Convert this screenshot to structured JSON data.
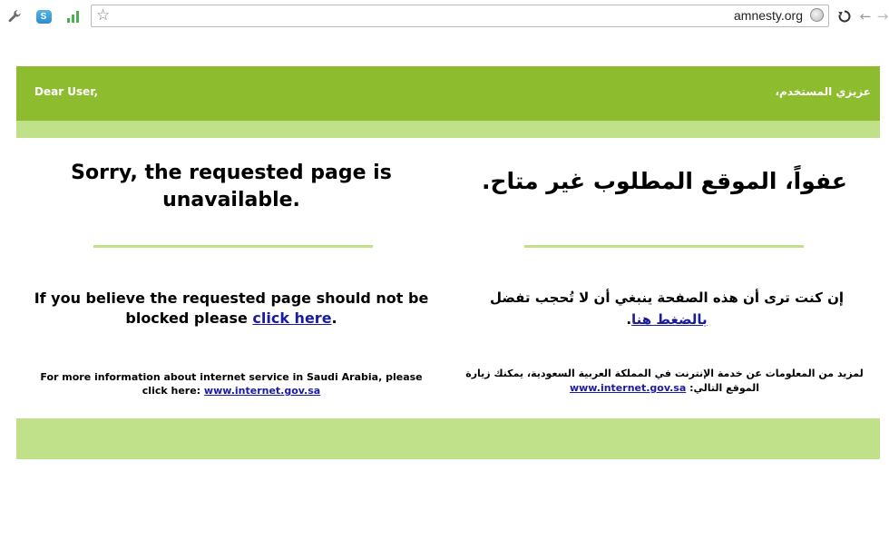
{
  "browser": {
    "url": "amnesty.org",
    "icons": {
      "menu": "wrench-icon",
      "extension_1": "skype-icon",
      "extension_2": "signal-bars-icon",
      "bookmark": "star-icon",
      "site_info": "globe-icon",
      "reload": "reload-icon",
      "back": "back-arrow-icon",
      "forward": "forward-arrow-icon"
    }
  },
  "colors": {
    "banner_dark": "#8dbd2e",
    "banner_light": "#c0e089",
    "link": "#1b1b9f"
  },
  "page": {
    "greeting_en": "Dear User,",
    "greeting_ar": "عزيزي المستخدم،",
    "title_en": "Sorry, the requested page is unavailable.",
    "title_ar": "عفواً، الموقع المطلوب غير متاح.",
    "message_en_prefix": "If you believe the requested page should not be blocked please ",
    "message_en_link": "click here",
    "message_en_suffix": ".",
    "message_ar_prefix": "إن كنت ترى أن هذه الصفحة ينبغي أن لا تُحجب تفضل ",
    "message_ar_link": "بالضغط هنا",
    "message_ar_suffix": ".",
    "info_en_prefix": "For more information about internet service in Saudi Arabia, please click here: ",
    "info_en_link": "www.internet.gov.sa",
    "info_ar_prefix": "لمزيد من المعلومات عن خدمة الإنترنت في المملكة العربية السعودية، يمكنك زيارة الموقع التالي: ",
    "info_ar_link": "www.internet.gov.sa"
  }
}
